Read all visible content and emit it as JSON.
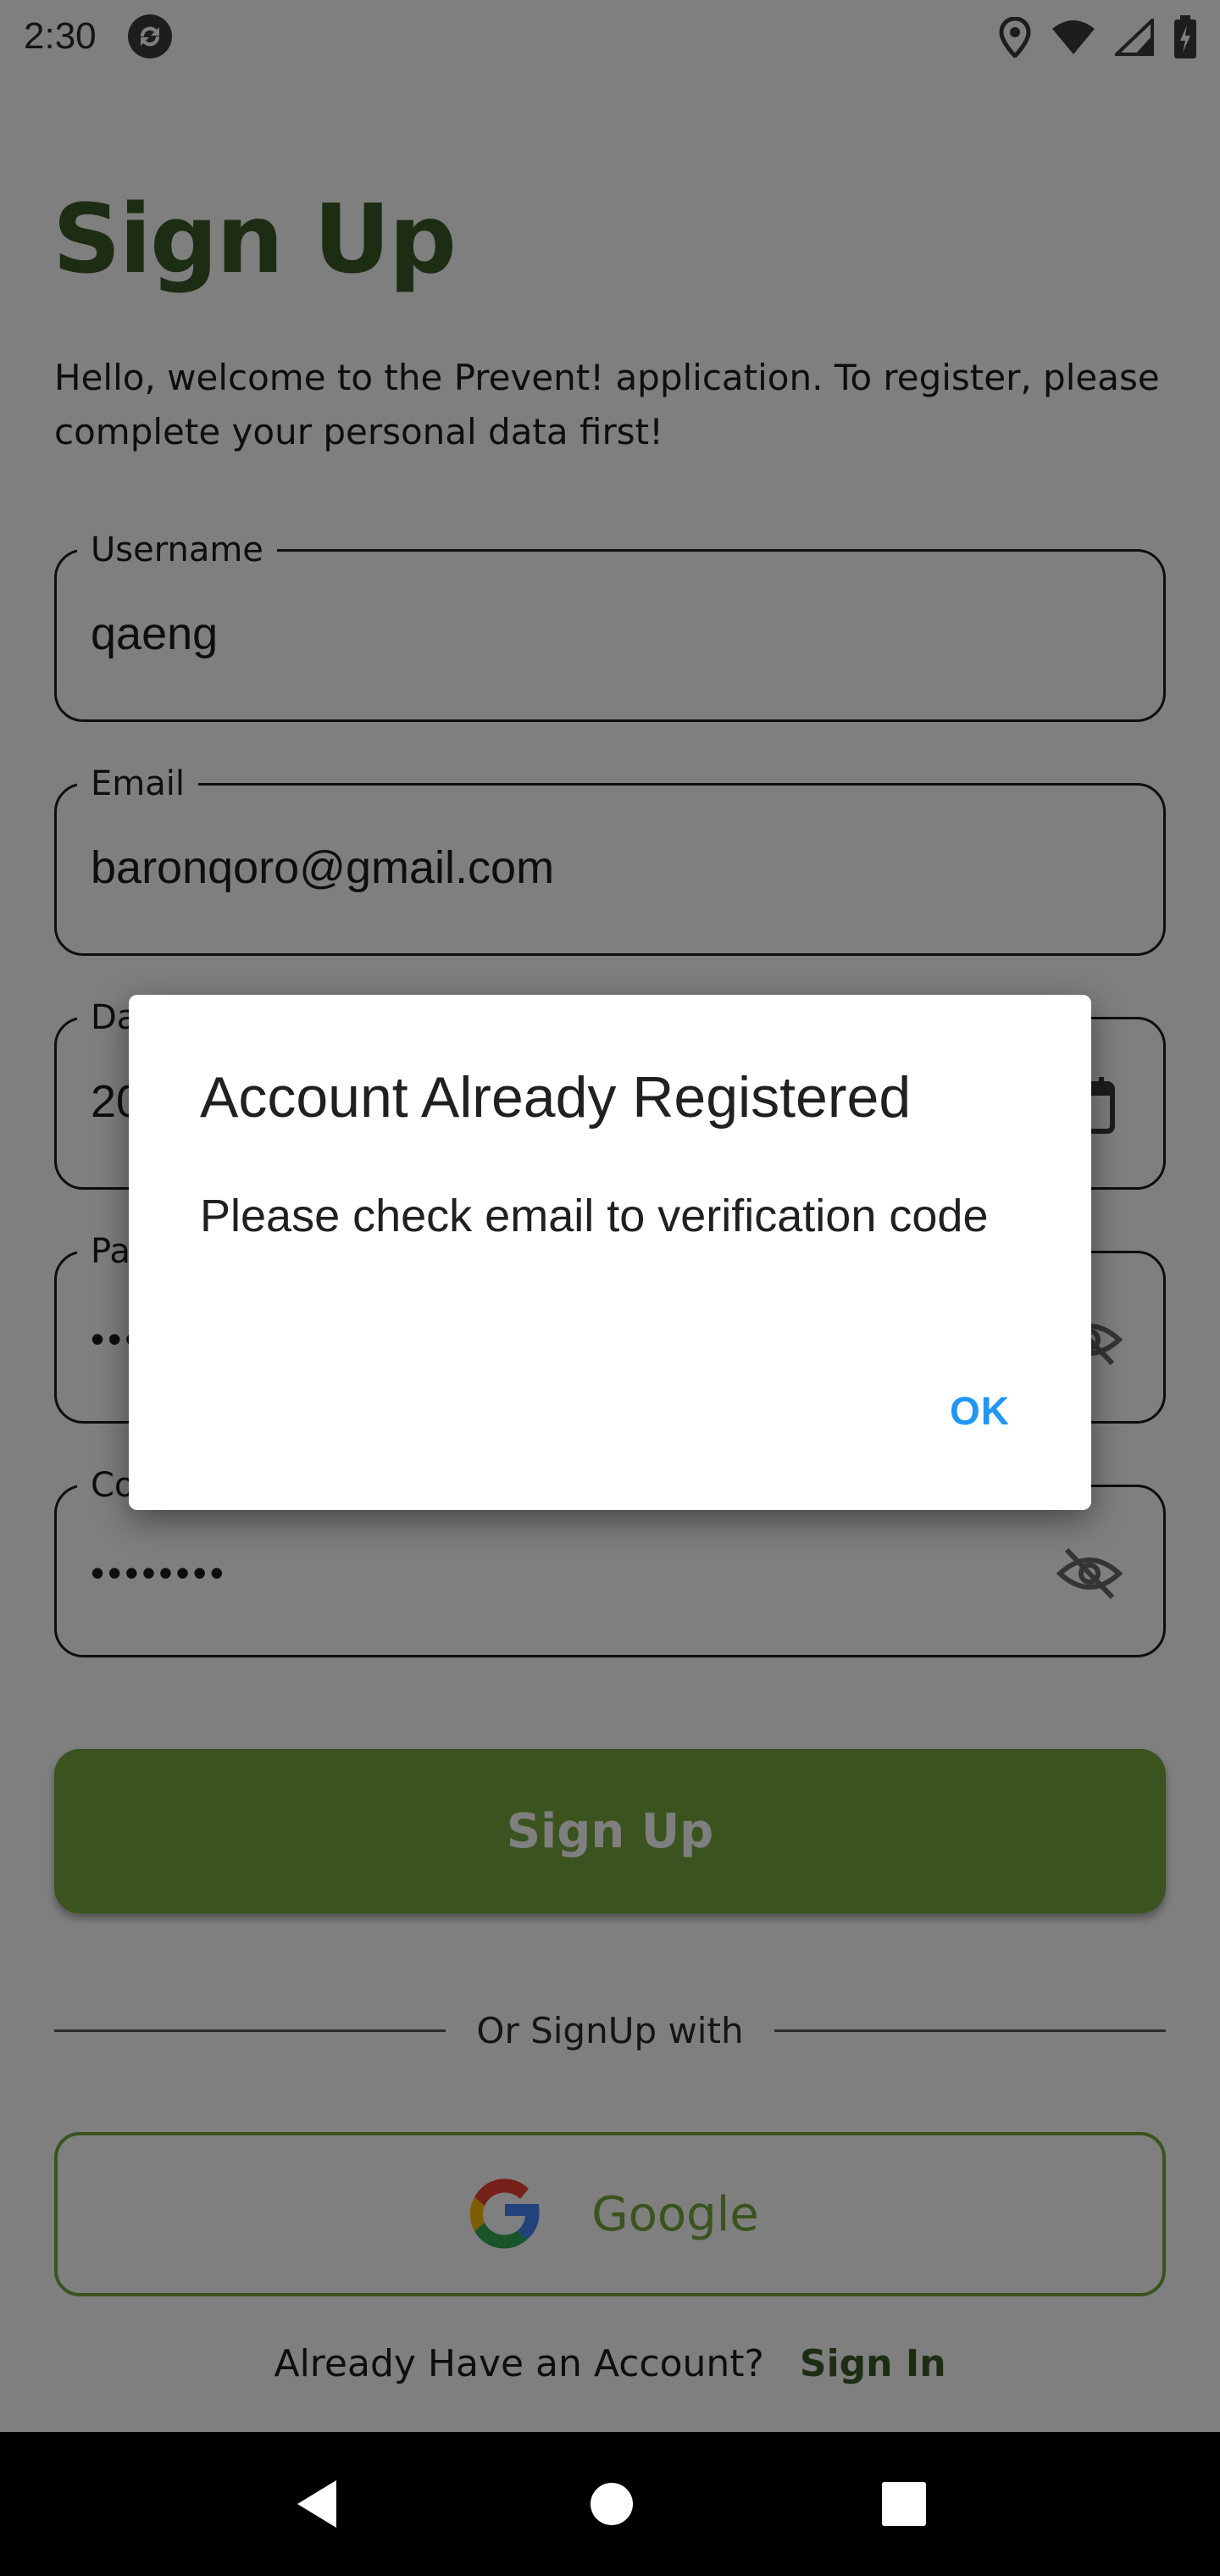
{
  "status_bar": {
    "time": "2:30",
    "icons": [
      "app-sync-icon",
      "location-icon",
      "wifi-icon",
      "signal-icon",
      "battery-icon"
    ]
  },
  "page": {
    "title": "Sign Up",
    "intro": "Hello, welcome to the Prevent! application. To register, please complete your personal data first!"
  },
  "form": {
    "username": {
      "label": "Username",
      "value": "qaeng"
    },
    "email": {
      "label": "Email",
      "value": "baronqoro@gmail.com"
    },
    "date": {
      "label": "Date of Birth",
      "value": "2023-05-01",
      "icon": "calendar-icon"
    },
    "password": {
      "label": "Password",
      "value": "••••••••",
      "icon": "eye-off-icon"
    },
    "confirm_password": {
      "label": "Confirm Password",
      "value": "••••••••",
      "icon": "eye-off-icon"
    }
  },
  "buttons": {
    "signup": "Sign Up",
    "divider": "Or SignUp with",
    "google": "Google"
  },
  "footer": {
    "prompt": "Already Have an Account?",
    "signin_link": "Sign In"
  },
  "dialog": {
    "title": "Account Already Registered",
    "message": "Please check email to verification code",
    "ok_label": "OK"
  },
  "colors": {
    "brand_green": "#76a73f",
    "title_green": "#3a5a27",
    "dialog_accent": "#2196f3"
  }
}
